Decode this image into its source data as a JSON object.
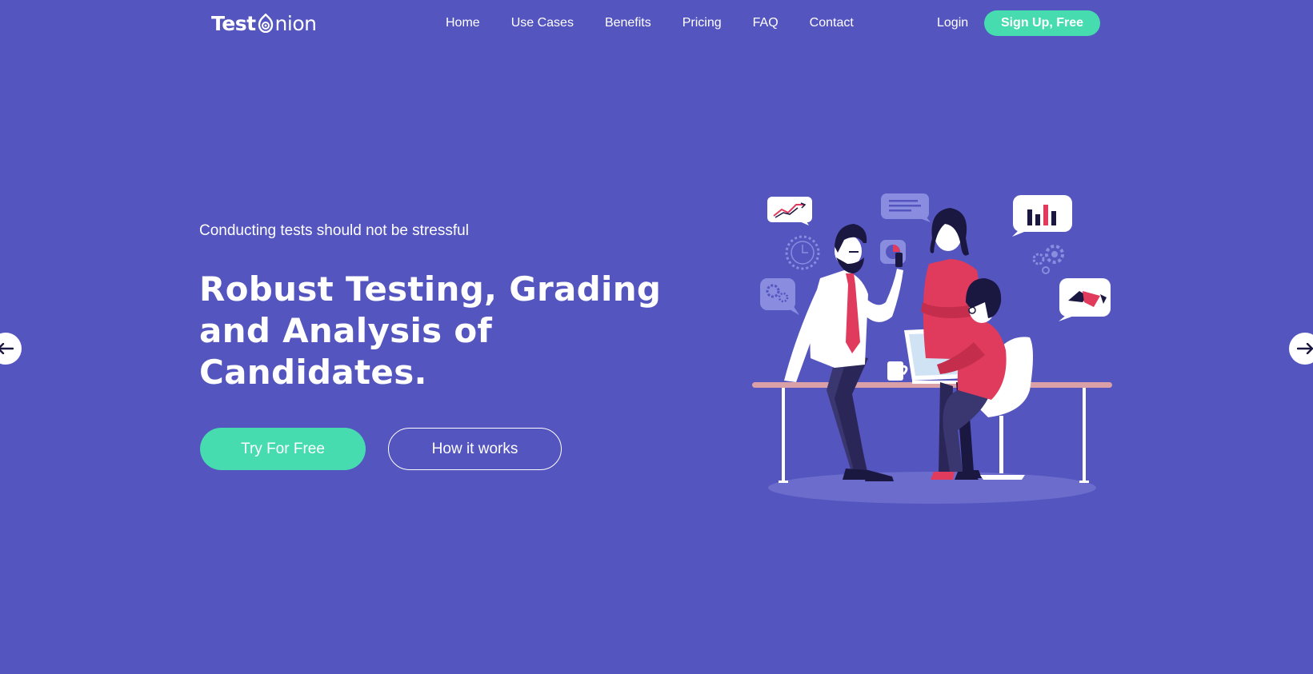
{
  "brand": {
    "part1": "Test",
    "part2": "nion"
  },
  "nav": {
    "links": [
      "Home",
      "Use Cases",
      "Benefits",
      "Pricing",
      "FAQ",
      "Contact"
    ],
    "login": "Login",
    "signup": "Sign Up, Free"
  },
  "hero": {
    "subtitle": "Conducting tests should not be stressful",
    "headline_lines": [
      "Robust Testing, Grading",
      "and Analysis of",
      "Candidates."
    ],
    "primary_cta": "Try For Free",
    "secondary_cta": "How it works"
  },
  "colors": {
    "background": "#5455bf",
    "accent": "#47dbb0",
    "illustration_red": "#e03a5c",
    "illustration_dark": "#1a1740"
  },
  "icons": {
    "prev": "arrow-left-icon",
    "next": "arrow-right-icon",
    "logo_mark": "onion-icon"
  }
}
